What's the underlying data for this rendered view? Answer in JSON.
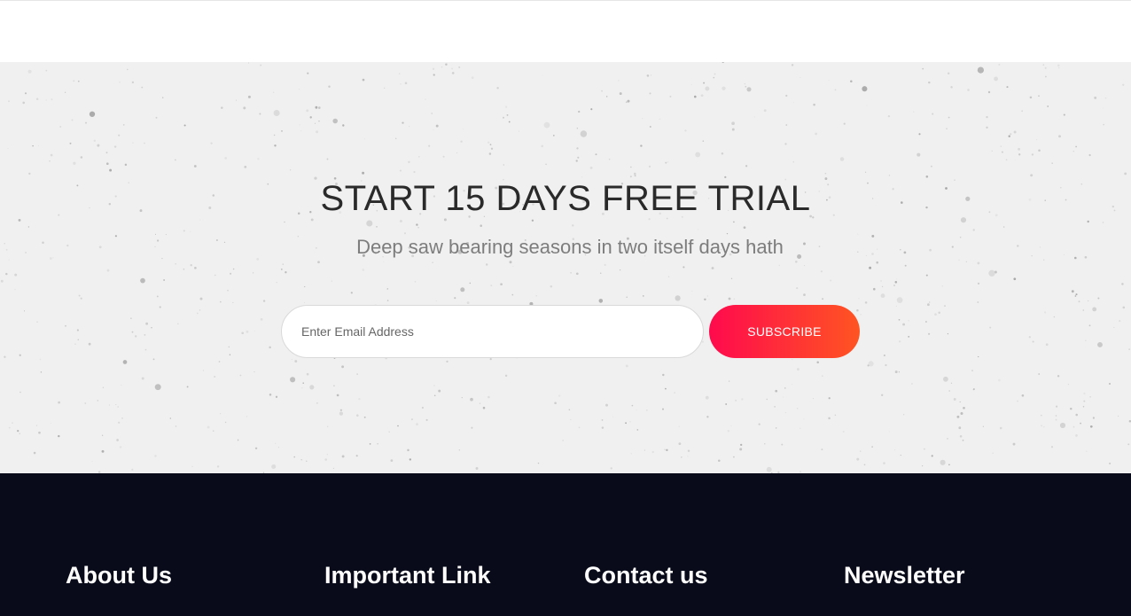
{
  "trial": {
    "title": "START 15 DAYS FREE TRIAL",
    "subtitle": "Deep saw bearing seasons in two itself days hath",
    "email_placeholder": "Enter Email Address",
    "subscribe_label": "SUBSCRIBE"
  },
  "footer": {
    "headings": [
      "About Us",
      "Important Link",
      "Contact us",
      "Newsletter"
    ]
  },
  "colors": {
    "trial_background": "#f0f0f0",
    "button_gradient_start": "#ff0a4d",
    "button_gradient_end": "#ff5422",
    "footer_background": "#090b1a"
  }
}
